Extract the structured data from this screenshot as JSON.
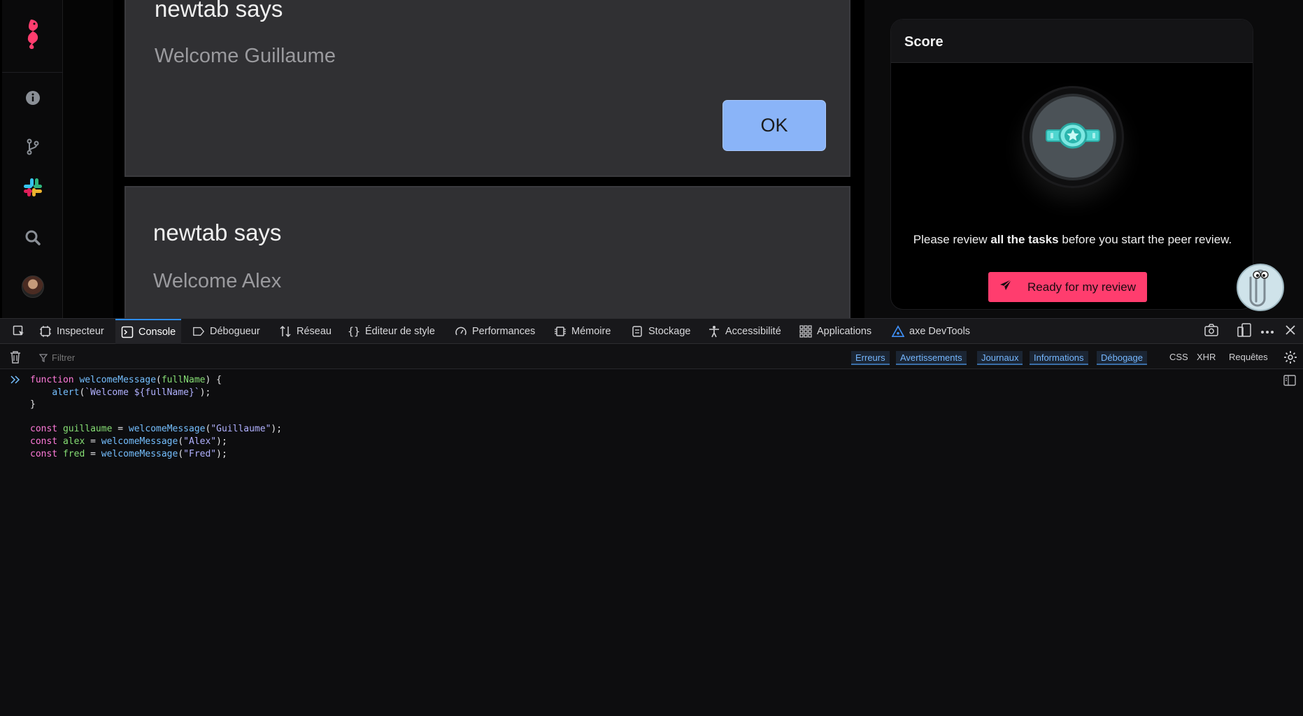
{
  "sidebar": {
    "items": [
      {
        "name": "logo",
        "icon": "seahorse-icon"
      },
      {
        "name": "info",
        "icon": "info-icon"
      },
      {
        "name": "branch",
        "icon": "git-branch-icon"
      },
      {
        "name": "slack",
        "icon": "slack-icon"
      },
      {
        "name": "search",
        "icon": "search-icon"
      },
      {
        "name": "profile",
        "icon": "avatar"
      }
    ]
  },
  "alerts": [
    {
      "title": "newtab says",
      "message": "Welcome Guillaume",
      "button": "OK"
    },
    {
      "title": "newtab says",
      "message": "Welcome Alex"
    }
  ],
  "score": {
    "title": "Score",
    "review_prefix": "Please review ",
    "review_bold": "all the tasks",
    "review_suffix": " before you start the peer review.",
    "button": "Ready for my review"
  },
  "devtools": {
    "tabs": [
      {
        "label": "Inspecteur",
        "icon": "inspector-icon"
      },
      {
        "label": "Console",
        "icon": "console-icon",
        "active": true
      },
      {
        "label": "Débogueur",
        "icon": "debugger-icon"
      },
      {
        "label": "Réseau",
        "icon": "network-icon"
      },
      {
        "label": "Éditeur de style",
        "icon": "style-editor-icon"
      },
      {
        "label": "Performances",
        "icon": "performance-icon"
      },
      {
        "label": "Mémoire",
        "icon": "memory-icon"
      },
      {
        "label": "Stockage",
        "icon": "storage-icon"
      },
      {
        "label": "Accessibilité",
        "icon": "accessibility-icon"
      },
      {
        "label": "Applications",
        "icon": "applications-icon"
      },
      {
        "label": "axe DevTools",
        "icon": "axe-icon"
      }
    ],
    "filter_placeholder": "Filtrer",
    "levels": [
      "Erreurs",
      "Avertissements",
      "Journaux",
      "Informations",
      "Débogage"
    ],
    "requests": [
      "CSS",
      "XHR",
      "Requêtes"
    ],
    "code": [
      "function welcomeMessage(fullName) {",
      "    alert(`Welcome ${fullName}`);",
      "}",
      "",
      "const guillaume = welcomeMessage(\"Guillaume\");",
      "const alex = welcomeMessage(\"Alex\");",
      "const fred = welcomeMessage(\"Fred\");"
    ]
  },
  "colors": {
    "accent_pink": "#ff3d6e",
    "ok_blue": "#8ab4f8",
    "devtools_blue": "#2d8cf0"
  }
}
